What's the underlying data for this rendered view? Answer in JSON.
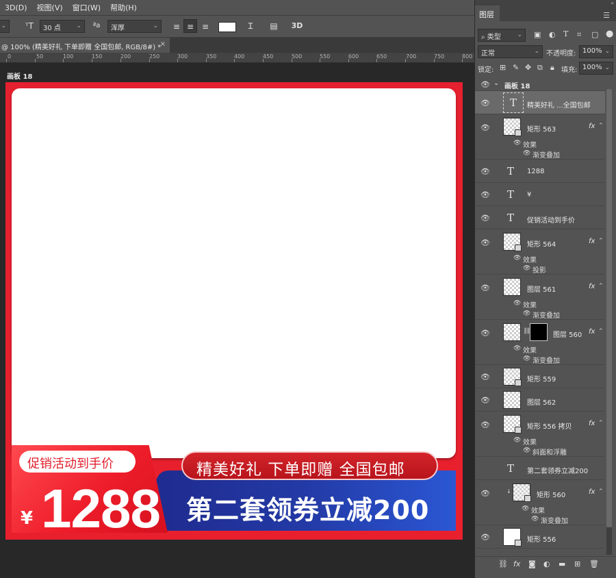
{
  "menubar": {
    "items": [
      "3D(D)",
      "视图(V)",
      "窗口(W)",
      "帮助(H)"
    ]
  },
  "options": {
    "font_size": "30 点",
    "aa_label": "ªa",
    "aa_mode": "浑厚",
    "warp_label": "Ɪ",
    "threed_label": "3D"
  },
  "document_tab": {
    "title": "@ 100% (精美好礼 下单即赠 全国包邮, RGB/8#) *",
    "close": "×"
  },
  "ruler": {
    "labels": [
      "0",
      "50",
      "100",
      "150",
      "200",
      "250",
      "300",
      "350",
      "400",
      "450",
      "500",
      "550",
      "600",
      "650",
      "700",
      "750",
      "800"
    ]
  },
  "artboard": {
    "label": "画板 18",
    "promo_label": "促销活动到手价",
    "yen": "¥",
    "price": "1288",
    "gift_banner": "精美好礼 下单即赠 全国包邮",
    "coupon_banner": "第二套领券立减200",
    "colors": {
      "red": "#e5202f",
      "blue": "#233aa6",
      "white": "#ffffff"
    }
  },
  "panel": {
    "tab": "图层",
    "filter_label": "类型",
    "blend_mode": "正常",
    "opacity_label": "不透明度:",
    "opacity": "100%",
    "lock_label": "锁定:",
    "fill_label": "填充:",
    "fill": "100%",
    "group_name": "画板 18",
    "layers": [
      {
        "name": "精美好礼 ...全国包邮",
        "kind": "text",
        "selected": true
      },
      {
        "name": "矩形 563",
        "kind": "shape",
        "fx": "fx",
        "effects_label": "效果",
        "effects": [
          "渐变叠加"
        ]
      },
      {
        "name": "1288",
        "kind": "text"
      },
      {
        "name": "¥",
        "kind": "text"
      },
      {
        "name": "促销活动到手价",
        "kind": "text"
      },
      {
        "name": "矩形 564",
        "kind": "shape",
        "fx": "fx",
        "effects_label": "效果",
        "effects": [
          "投影"
        ]
      },
      {
        "name": "图层 561",
        "kind": "pixel",
        "fx": "fx",
        "effects_label": "效果",
        "effects": [
          "渐变叠加"
        ]
      },
      {
        "name": "图层 560",
        "kind": "pixel-mask",
        "fx": "fx",
        "effects_label": "效果",
        "effects": [
          "渐变叠加"
        ]
      },
      {
        "name": "矩形 559",
        "kind": "shape"
      },
      {
        "name": "图层 562",
        "kind": "pixel"
      },
      {
        "name": "矩形 556 拷贝",
        "kind": "shape",
        "fx": "fx",
        "effects_label": "效果",
        "effects": [
          "斜面和浮雕"
        ]
      },
      {
        "name": "第二套领券立减200",
        "kind": "text"
      },
      {
        "name": "矩形 560",
        "kind": "shape",
        "fx": "fx",
        "effects_label": "效果",
        "effects": [
          "渐变叠加"
        ]
      },
      {
        "name": "矩形 556",
        "kind": "shape"
      }
    ],
    "footer_icons": [
      "link-icon",
      "fx-icon",
      "mask-icon",
      "adjustment-icon",
      "folder-icon",
      "new-layer-icon",
      "trash-icon"
    ],
    "footer_fx": "fx"
  }
}
